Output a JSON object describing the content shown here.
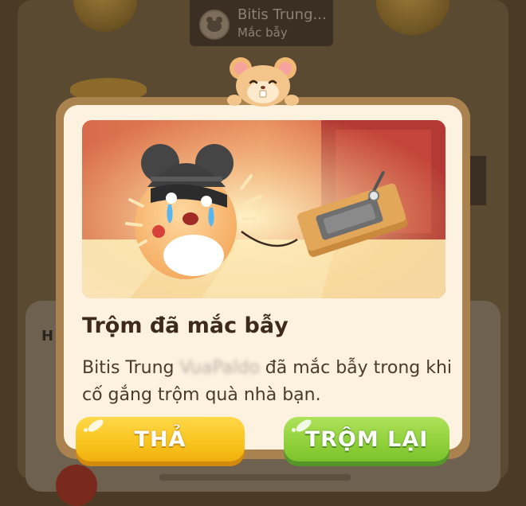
{
  "background": {
    "player_card": {
      "name": "Bitis Trung...",
      "status": "Mắc bẫy"
    },
    "bottom_panel_letter": "H"
  },
  "modal": {
    "title": "Trộm đã mắc bẫy",
    "message_prefix": "Bitis Trung",
    "message_hidden_name": "VuaPaldo",
    "message_suffix": "đã mắc bẫy trong khi cố gắng trộm quà nhà bạn.",
    "release_button_label": "THẢ",
    "steal_back_button_label": "TRỘM LẠI"
  },
  "colors": {
    "modal_frame": "#a9824f",
    "modal_fill": "#fdf2df",
    "release_button": "#f8c31c",
    "steal_back_button": "#8fd03a",
    "title_text": "#3d2a1c"
  },
  "icons": {
    "mascot": "hamster-head-icon",
    "scene": "thief-hamster-mousetrap-illustration",
    "avatar_placeholder": "avatar-icon"
  }
}
